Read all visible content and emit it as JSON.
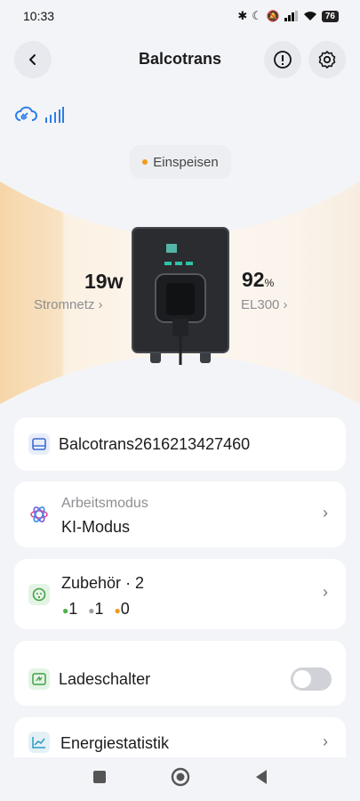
{
  "status": {
    "time": "10:33",
    "battery": "76"
  },
  "header": {
    "title": "Balcotrans"
  },
  "mode": {
    "label": "Einspeisen"
  },
  "flow": {
    "grid_value": "19",
    "grid_unit": "w",
    "grid_label": "Stromnetz",
    "battery_value": "92",
    "battery_unit": "%",
    "battery_label": "EL300"
  },
  "cards": {
    "device_name": "Balcotrans2616213427460",
    "work_mode_title": "Arbeitsmodus",
    "work_mode_value": "KI-Modus",
    "accessories_title": "Zubehör",
    "accessories_sep": "· 2",
    "acc_green": "1",
    "acc_gray": "1",
    "acc_orange": "0",
    "charge_switch": "Ladeschalter",
    "energy_stats": "Energiestatistik"
  },
  "colors": {
    "accent_orange": "#f19a1b",
    "green": "#4caf50",
    "gray": "#9e9e9e",
    "link_blue": "#2b7de9"
  }
}
